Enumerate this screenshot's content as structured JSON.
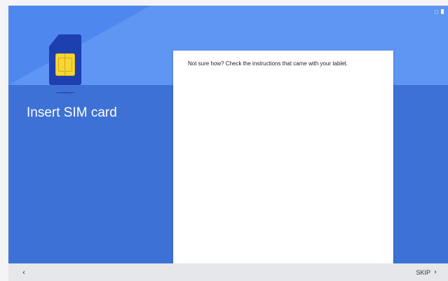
{
  "page": {
    "title": "Insert SIM card",
    "instruction": "Not sure how? Check the instructions that came with your tablet."
  },
  "navigation": {
    "back_icon": "‹",
    "skip_label": "SKIP",
    "skip_icon": "›"
  },
  "icons": {
    "illustration": "sim-card-icon",
    "status": [
      "sim-status-icon",
      "battery-icon"
    ]
  },
  "colors": {
    "hero": "#5f95f3",
    "content": "#3e71d6",
    "sim_card": "#1d3fb0",
    "sim_chip": "#f5d633",
    "nav_bar": "#e6e7ea"
  }
}
